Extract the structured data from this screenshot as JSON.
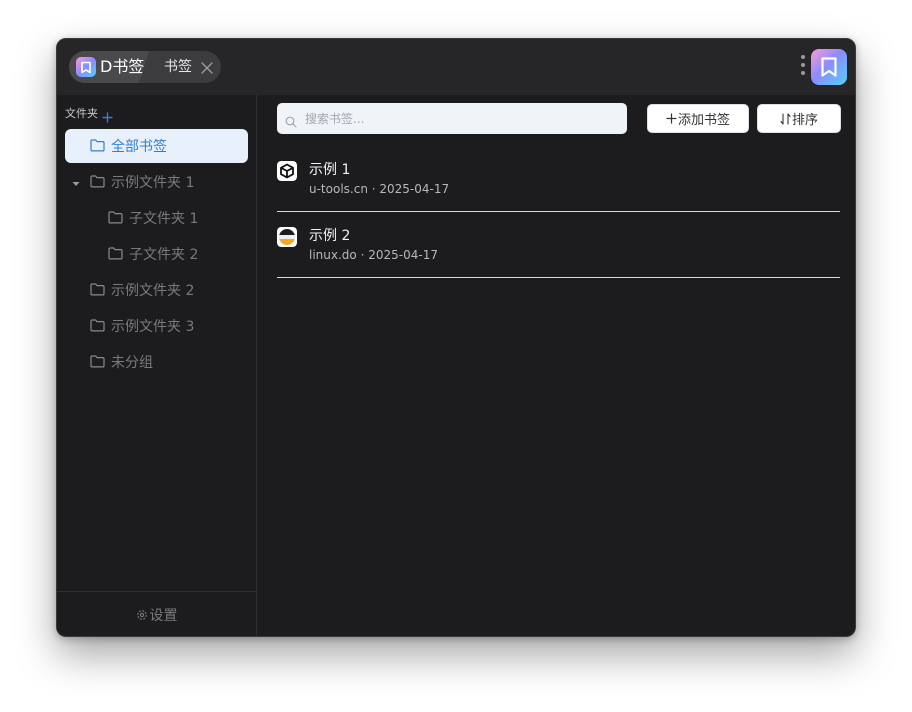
{
  "titlebar": {
    "app_name": "D书签",
    "tab_label": "书签"
  },
  "sidebar": {
    "header_label": "文件夹",
    "folders": [
      {
        "label": "全部书签",
        "active": true
      },
      {
        "label": "示例文件夹 1",
        "expanded": true
      },
      {
        "label": "子文件夹 1"
      },
      {
        "label": "子文件夹 2"
      },
      {
        "label": "示例文件夹 2"
      },
      {
        "label": "示例文件夹 3"
      },
      {
        "label": "未分组"
      }
    ],
    "settings_label": "设置"
  },
  "toolbar": {
    "search_placeholder": "搜索书签...",
    "add_label": "添加书签",
    "sort_label": "排序"
  },
  "bookmarks": [
    {
      "title": "示例 1",
      "domain": "u-tools.cn",
      "date": "· 2025-04-17",
      "icon": "utools-icon"
    },
    {
      "title": "示例 2",
      "domain": "linux.do",
      "date": "· 2025-04-17",
      "icon": "linuxdo-icon"
    }
  ],
  "colors": {
    "accent": "#2f7fd8",
    "background": "#1c1c1e",
    "titlebar": "#262628"
  }
}
